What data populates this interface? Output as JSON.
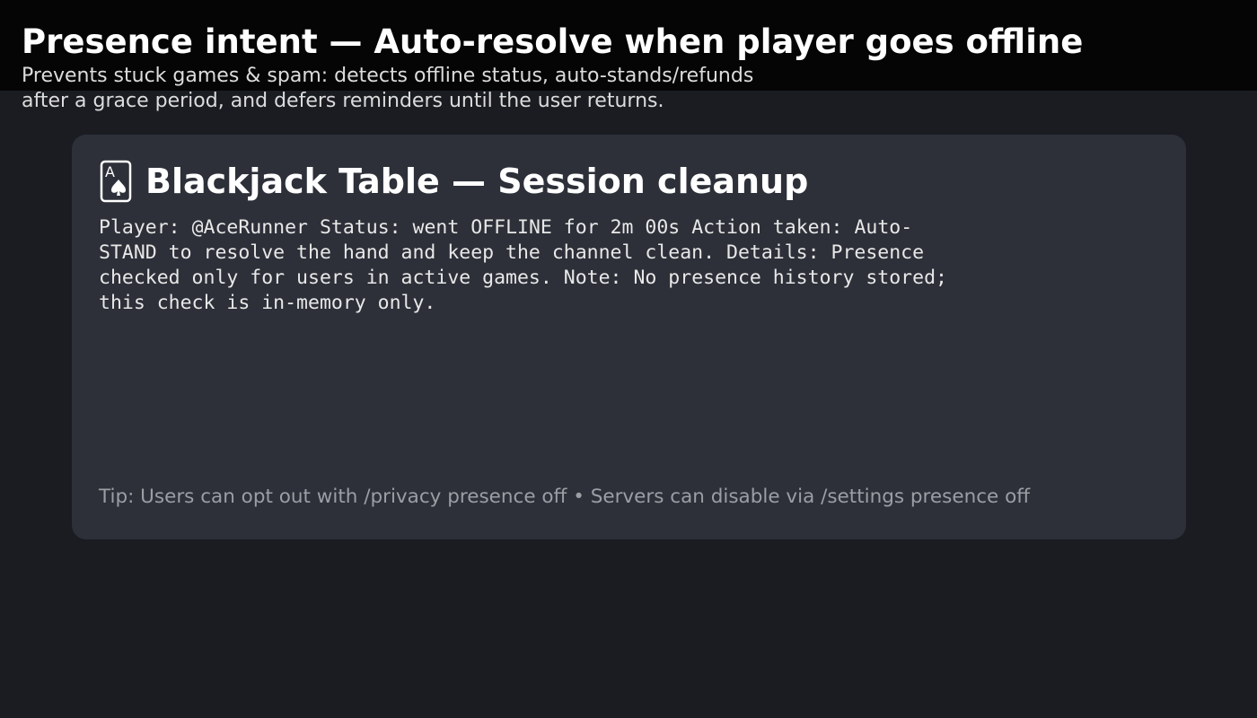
{
  "header": {
    "title": "Presence intent — Auto-resolve when player goes offline",
    "subtitle": "Prevents stuck games & spam: detects offline status, auto-stands/refunds after a grace period, and defers reminders until the user returns."
  },
  "card": {
    "icon": "playing-card-ace-of-spades-icon",
    "title": "Blackjack Table — Session cleanup",
    "body": {
      "player_label": "Player:",
      "player": "@AceRunner",
      "status_label": "Status:",
      "status": "went OFFLINE for 2m 00s",
      "action_label": "Action taken:",
      "action": "Auto-STAND to resolve the hand and keep the channel clean.",
      "details_label": "Details:",
      "details": "Presence checked only for users in active games.",
      "note_label": "Note:",
      "note": "No presence history stored; this check is in-memory only."
    },
    "tip": "Tip: Users can opt out with /privacy presence off • Servers can disable via /settings presence off"
  },
  "colors": {
    "page_background": "#1a1c22",
    "header_background": "#050505",
    "card_background": "#2d3039",
    "title_text": "#ffffff",
    "tip_text": "#9c9ea4"
  }
}
